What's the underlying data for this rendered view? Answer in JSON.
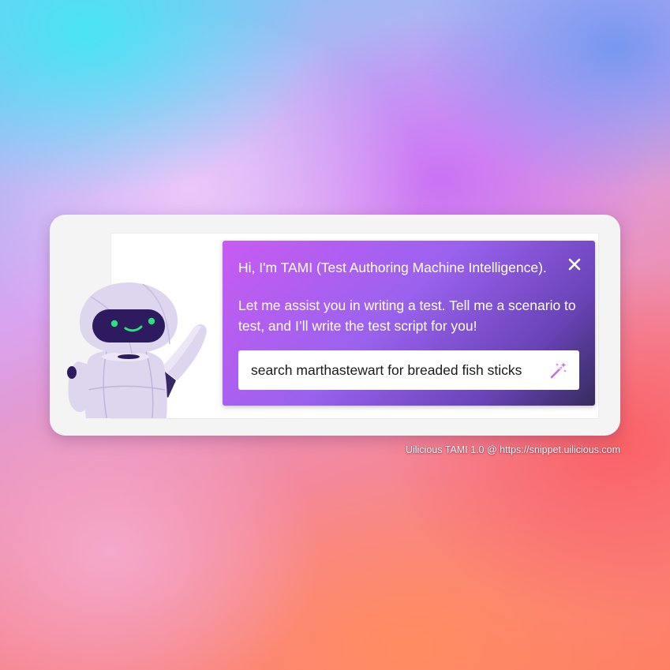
{
  "tami_dialog": {
    "greeting": "Hi, I'm TAMI (Test Authoring Machine Intelligence).",
    "instruction": "Let me assist you in writing a test. Tell me a scenario to test, and I’ll write the test script for you!",
    "prompt_value": "search marthastewart for breaded fish sticks",
    "close_icon": "close-icon",
    "submit_icon": "magic-wand-icon"
  },
  "mascot": {
    "icon": "robot-mascot"
  },
  "caption": "Uilicious TAMI 1.0 @ https://snippet.uilicious.com",
  "colors": {
    "dialog_gradient_start": "#c85bf2",
    "dialog_gradient_end": "#352b5c",
    "robot_body": "#ddd6ee",
    "robot_visor": "#2e1a5e",
    "robot_eyes": "#2ee07a"
  }
}
